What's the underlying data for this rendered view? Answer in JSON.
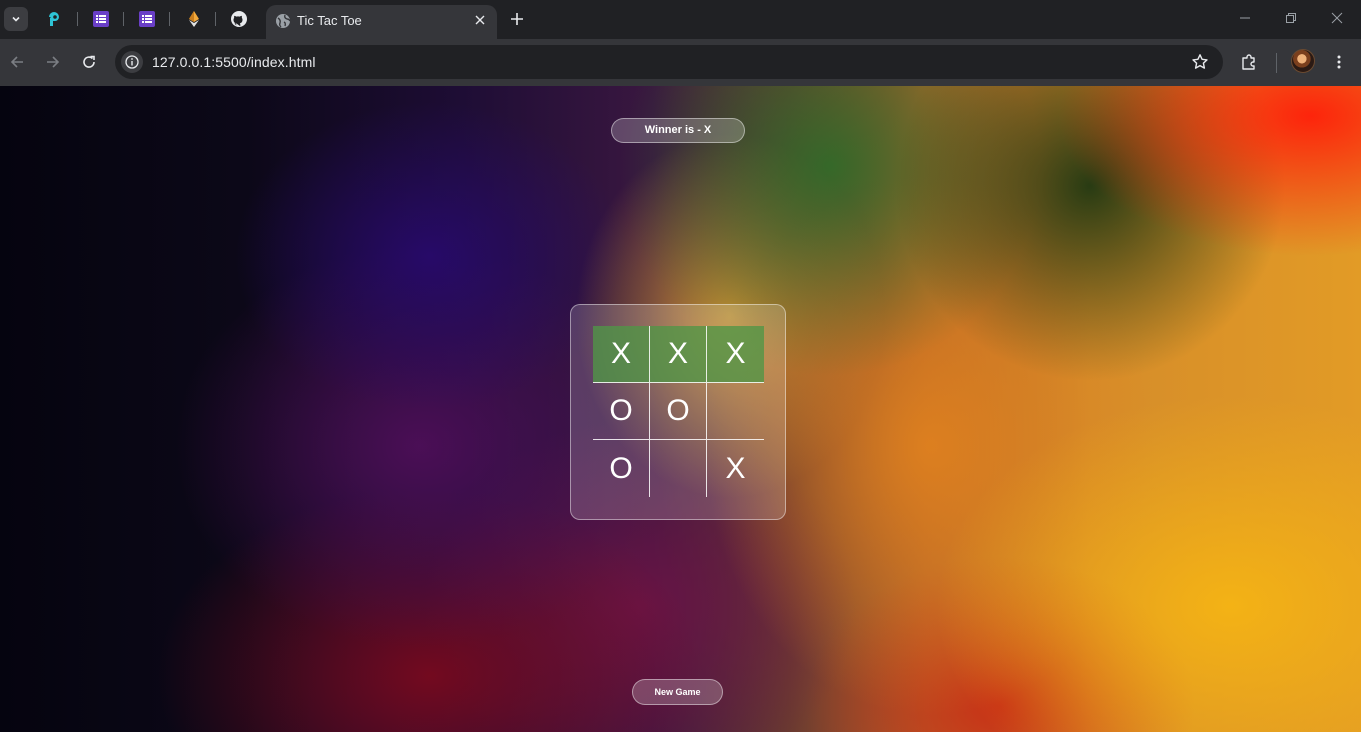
{
  "browser": {
    "tab": {
      "title": "Tic Tac Toe",
      "favicon": "globe-icon"
    },
    "pinned_tabs": [
      "pinned-app-icon",
      "list-icon",
      "list-icon",
      "ethereum-icon",
      "github-icon"
    ],
    "address": "127.0.0.1:5500/index.html",
    "accent": "#35363a"
  },
  "game": {
    "winner_text": "Winner is - X",
    "board": [
      [
        "X",
        "X",
        "X"
      ],
      [
        "O",
        "O",
        ""
      ],
      [
        "O",
        "",
        "X"
      ]
    ],
    "winning_row_color": "#4f9646",
    "new_game_label": "New Game"
  }
}
